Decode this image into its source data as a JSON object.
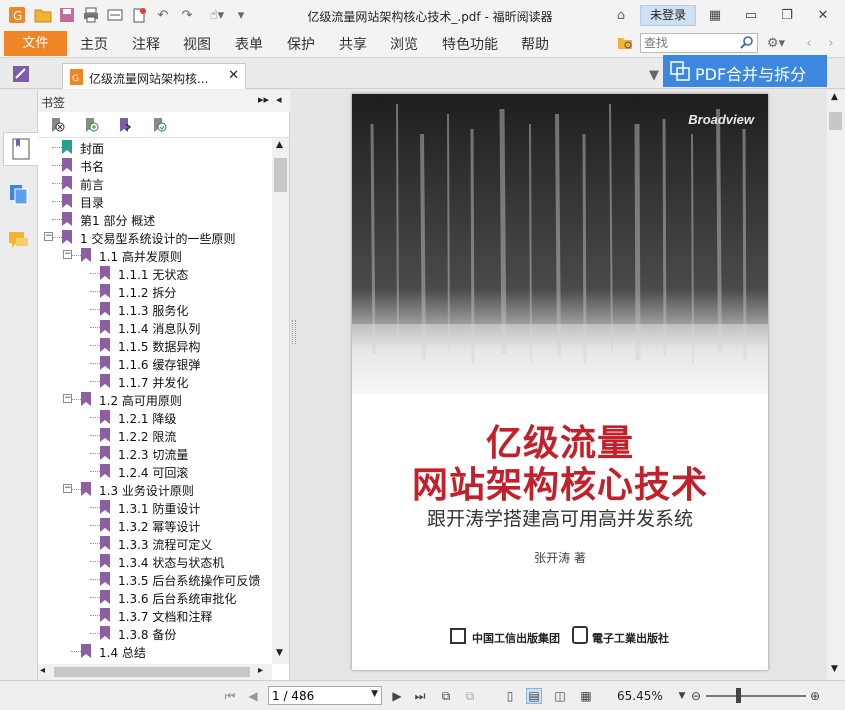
{
  "app": {
    "title": "亿级流量网站架构核心技术_.pdf - 福昕阅读器",
    "login_label": "未登录"
  },
  "menu": {
    "file": "文件",
    "items": [
      "主页",
      "注释",
      "视图",
      "表单",
      "保护",
      "共享",
      "浏览",
      "特色功能",
      "帮助"
    ],
    "search_placeholder": "查找"
  },
  "tabs": {
    "doc_tab_label": "亿级流量网站架构核...",
    "merge_button": "PDF合并与拆分"
  },
  "bookmarks": {
    "panel_title": "书签",
    "items": [
      {
        "label": "封面",
        "level": 0,
        "toggle": "",
        "color": "#2a9d8f"
      },
      {
        "label": "书名",
        "level": 0,
        "toggle": "",
        "color": "#8e5ea2"
      },
      {
        "label": "前言",
        "level": 0,
        "toggle": "",
        "color": "#8e5ea2"
      },
      {
        "label": "目录",
        "level": 0,
        "toggle": "",
        "color": "#8e5ea2"
      },
      {
        "label": "第1 部分 概述",
        "level": 0,
        "toggle": "",
        "color": "#8e5ea2"
      },
      {
        "label": "1 交易型系统设计的一些原则",
        "level": 0,
        "toggle": "-",
        "color": "#8e5ea2"
      },
      {
        "label": "1.1 高并发原则",
        "level": 1,
        "toggle": "-",
        "color": "#8e5ea2"
      },
      {
        "label": "1.1.1 无状态",
        "level": 2,
        "toggle": "",
        "color": "#8e5ea2"
      },
      {
        "label": "1.1.2 拆分",
        "level": 2,
        "toggle": "",
        "color": "#8e5ea2"
      },
      {
        "label": "1.1.3 服务化",
        "level": 2,
        "toggle": "",
        "color": "#8e5ea2"
      },
      {
        "label": "1.1.4 消息队列",
        "level": 2,
        "toggle": "",
        "color": "#8e5ea2"
      },
      {
        "label": "1.1.5 数据异构",
        "level": 2,
        "toggle": "",
        "color": "#8e5ea2"
      },
      {
        "label": "1.1.6 缓存银弹",
        "level": 2,
        "toggle": "",
        "color": "#8e5ea2"
      },
      {
        "label": "1.1.7 并发化",
        "level": 2,
        "toggle": "",
        "color": "#8e5ea2"
      },
      {
        "label": "1.2 高可用原则",
        "level": 1,
        "toggle": "-",
        "color": "#8e5ea2"
      },
      {
        "label": "1.2.1 降级",
        "level": 2,
        "toggle": "",
        "color": "#8e5ea2"
      },
      {
        "label": "1.2.2 限流",
        "level": 2,
        "toggle": "",
        "color": "#8e5ea2"
      },
      {
        "label": "1.2.3 切流量",
        "level": 2,
        "toggle": "",
        "color": "#8e5ea2"
      },
      {
        "label": "1.2.4 可回滚",
        "level": 2,
        "toggle": "",
        "color": "#8e5ea2"
      },
      {
        "label": "1.3 业务设计原则",
        "level": 1,
        "toggle": "-",
        "color": "#8e5ea2"
      },
      {
        "label": "1.3.1 防重设计",
        "level": 2,
        "toggle": "",
        "color": "#8e5ea2"
      },
      {
        "label": "1.3.2 幂等设计",
        "level": 2,
        "toggle": "",
        "color": "#8e5ea2"
      },
      {
        "label": "1.3.3 流程可定义",
        "level": 2,
        "toggle": "",
        "color": "#8e5ea2"
      },
      {
        "label": "1.3.4 状态与状态机",
        "level": 2,
        "toggle": "",
        "color": "#8e5ea2"
      },
      {
        "label": "1.3.5 后台系统操作可反馈",
        "level": 2,
        "toggle": "",
        "color": "#8e5ea2"
      },
      {
        "label": "1.3.6 后台系统审批化",
        "level": 2,
        "toggle": "",
        "color": "#8e5ea2"
      },
      {
        "label": "1.3.7 文档和注释",
        "level": 2,
        "toggle": "",
        "color": "#8e5ea2"
      },
      {
        "label": "1.3.8 备份",
        "level": 2,
        "toggle": "",
        "color": "#8e5ea2"
      },
      {
        "label": "1.4 总结",
        "level": 1,
        "toggle": "",
        "color": "#8e5ea2"
      }
    ]
  },
  "cover": {
    "brand": "Broadview",
    "title_line1": "亿级流量",
    "title_line2": "网站架构核心技术",
    "subtitle": "跟开涛学搭建高可用高并发系统",
    "author": "张开涛    著",
    "publisher1": "中国工信出版集团",
    "publisher2": "電子工業出版社"
  },
  "status": {
    "page_value": "1 / 486",
    "zoom": "65.45%"
  },
  "colors": {
    "accent_orange": "#f08526",
    "accent_blue": "#3d88df",
    "cover_red": "#c2202a"
  }
}
